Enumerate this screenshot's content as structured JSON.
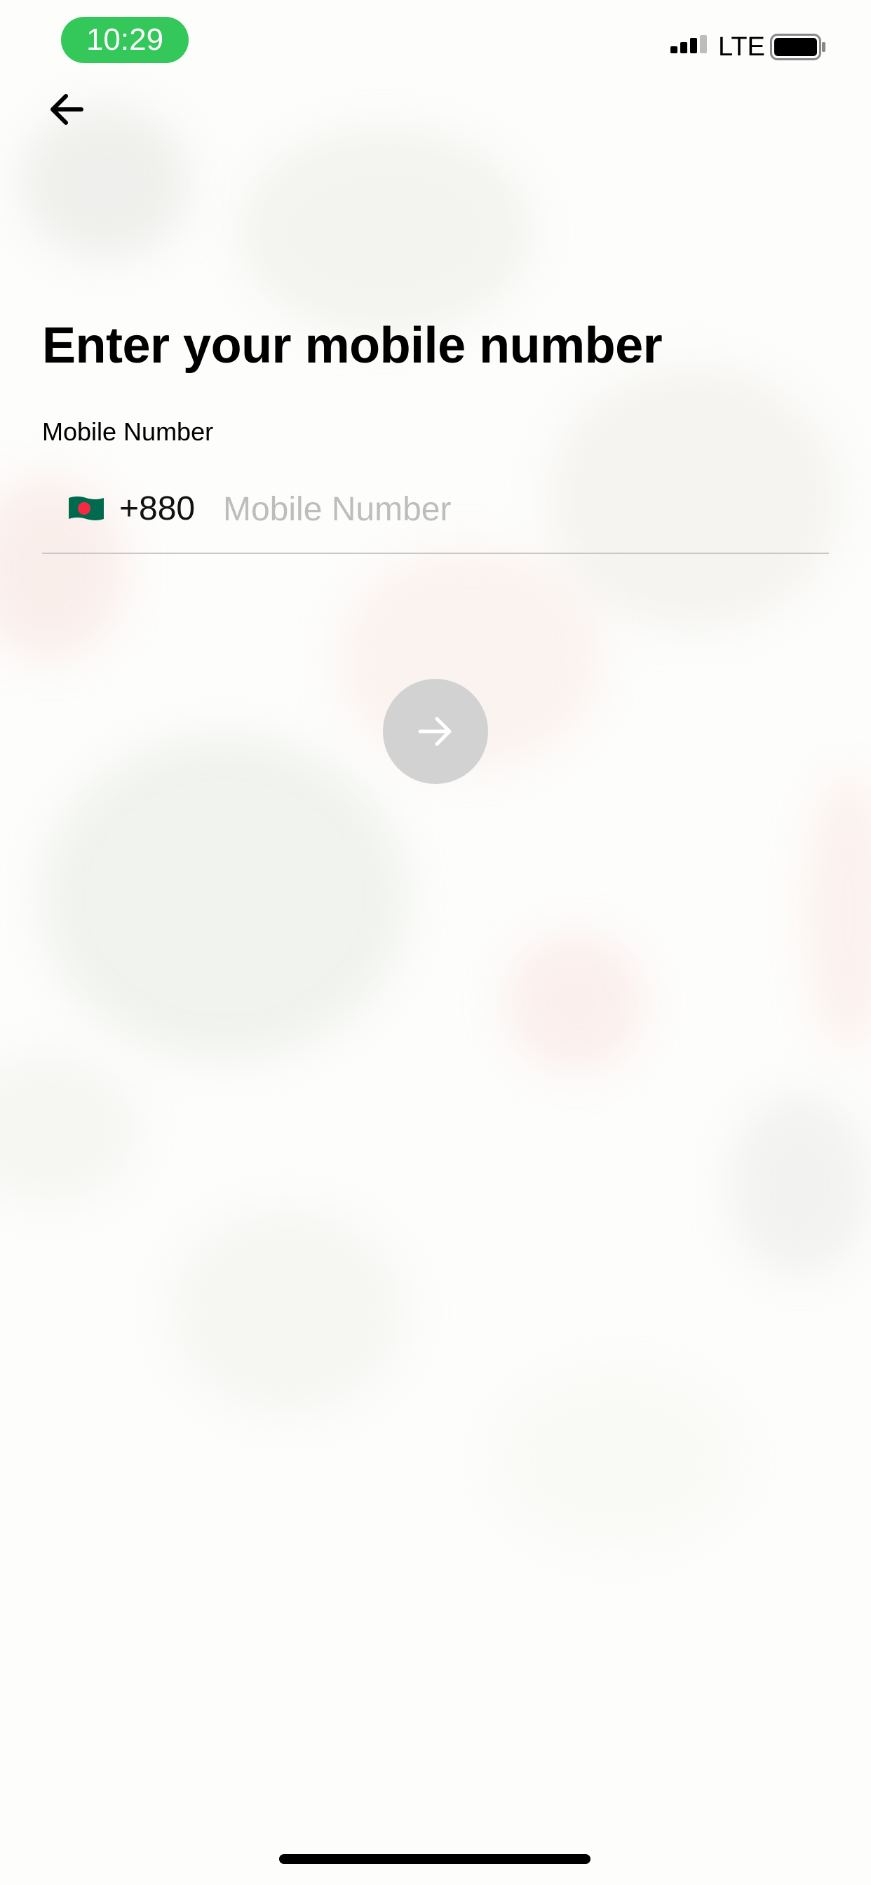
{
  "status_bar": {
    "time": "10:29",
    "network": "LTE",
    "icons": [
      "signal-icon",
      "battery-icon"
    ]
  },
  "header": {
    "back_icon": "back-arrow-icon"
  },
  "main": {
    "title": "Enter your mobile number",
    "field_label": "Mobile Number",
    "country_flag": "bangladesh-flag-icon",
    "country_code": "+880",
    "phone_placeholder": "Mobile Number",
    "phone_value": "",
    "next_icon": "arrow-right-icon"
  },
  "colors": {
    "time_pill": "#34c759",
    "next_button_disabled": "#d2d2d2",
    "placeholder": "#bdbdbd",
    "flag_green": "#006a4e",
    "flag_red": "#f42a41"
  }
}
